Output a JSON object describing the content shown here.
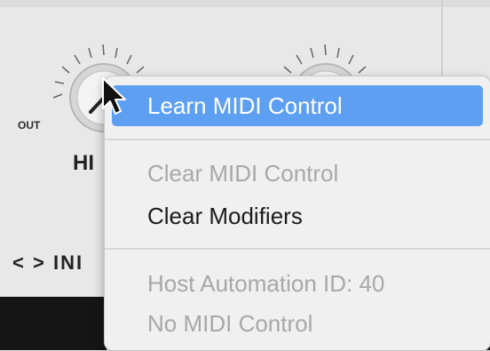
{
  "panel": {
    "out_label": "OUT",
    "knob_name": "HI",
    "nav_prev": "<",
    "nav_next": ">",
    "nav_label": "INI"
  },
  "context_menu": {
    "items": [
      {
        "label": "Learn MIDI Control",
        "state": "highlighted"
      },
      {
        "label": "Clear MIDI Control",
        "state": "disabled"
      },
      {
        "label": "Clear Modifiers",
        "state": "enabled"
      },
      {
        "label": "Host Automation ID: 40",
        "state": "disabled"
      },
      {
        "label": "No MIDI Control",
        "state": "disabled"
      }
    ]
  },
  "colors": {
    "highlight": "#5d9ff0",
    "disabled_text": "#a8a8a8",
    "menu_bg": "#f0f0f0"
  },
  "icons": [
    "knob-icon",
    "mouse-pointer-icon"
  ]
}
